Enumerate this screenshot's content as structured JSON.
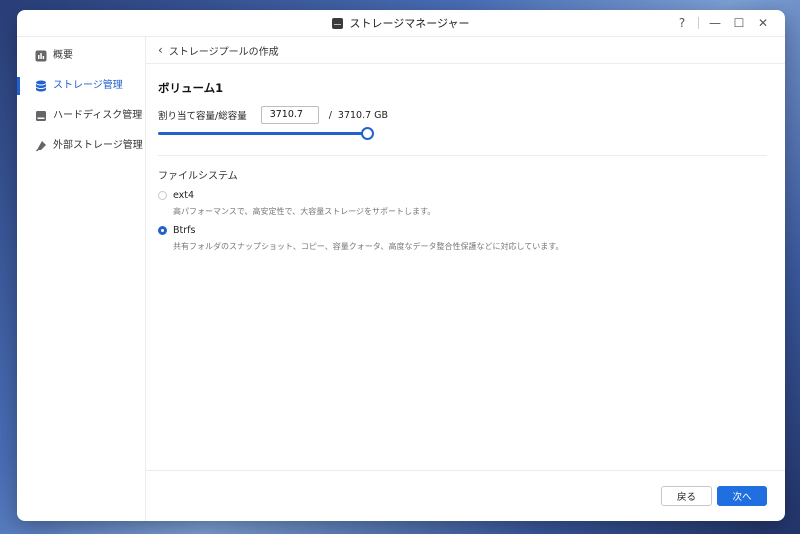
{
  "window": {
    "title": "ストレージマネージャー",
    "controls": {
      "help": "?",
      "minimize": "—",
      "maximize": "☐",
      "close": "✕"
    }
  },
  "sidebar": {
    "items": [
      {
        "label": "概要",
        "icon": "dashboard-icon",
        "active": false
      },
      {
        "label": "ストレージ管理",
        "icon": "database-icon",
        "active": true
      },
      {
        "label": "ハードディスク管理",
        "icon": "hdd-icon",
        "active": false
      },
      {
        "label": "外部ストレージ管理",
        "icon": "usb-icon",
        "active": false
      }
    ]
  },
  "breadcrumb": {
    "back_icon": "chevron-left-icon",
    "title": "ストレージプールの作成"
  },
  "volume": {
    "title": "ボリューム1",
    "alloc_label": "割り当て容量/総容量",
    "alloc_value": "3710.7",
    "separator": "/",
    "total": "3710.7 GB",
    "slider_fraction": 1.0
  },
  "filesystem": {
    "label": "ファイルシステム",
    "options": [
      {
        "name": "ext4",
        "desc": "高パフォーマンスで、高安定性で、大容量ストレージをサポートします。",
        "checked": false
      },
      {
        "name": "Btrfs",
        "desc": "共有フォルダのスナップショット、コピー、容量クォータ、高度なデータ整合性保護などに対応しています。",
        "checked": true
      }
    ]
  },
  "footer": {
    "back_label": "戻る",
    "next_label": "次へ"
  },
  "colors": {
    "accent": "#2361d0",
    "button_primary": "#1f6fe0"
  }
}
